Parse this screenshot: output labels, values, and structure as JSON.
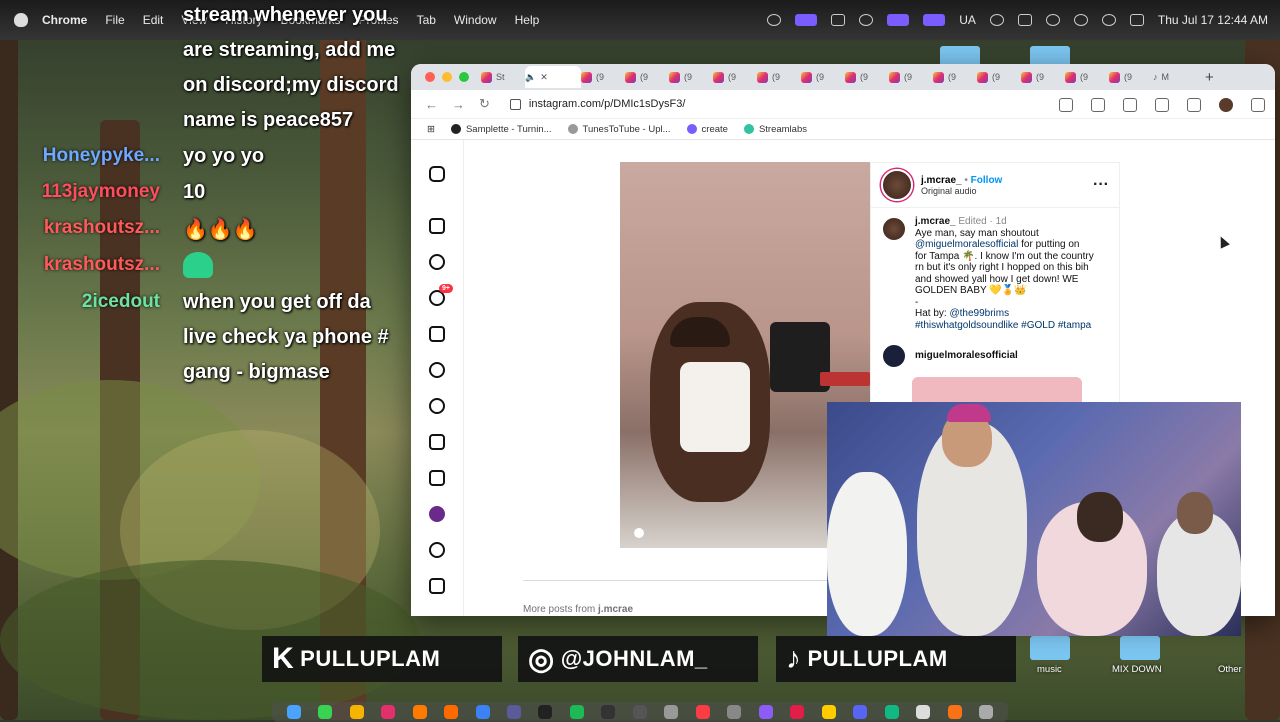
{
  "menubar": {
    "app": "Chrome",
    "items": [
      "File",
      "Edit",
      "View",
      "History",
      "Bookmarks",
      "Profiles",
      "Tab",
      "Window",
      "Help"
    ],
    "right": {
      "input": "UA",
      "datetime": "Thu Jul 17  12:44 AM"
    }
  },
  "chat": {
    "lines": [
      {
        "user": "",
        "text": "stream whenever you"
      },
      {
        "user": "",
        "text": "are streaming, add me"
      },
      {
        "user": "",
        "text": "on discord;my discord"
      },
      {
        "user": "",
        "text": "name is peace857"
      },
      {
        "user": "Honeypyke...",
        "text": "yo yo yo",
        "color": "#6fa8ff"
      },
      {
        "user": "113jaymoney",
        "text": "10",
        "color": "#ff4d5e"
      },
      {
        "user": "krashoutsz...",
        "text": "🔥🔥🔥",
        "color": "#ff5a5a"
      },
      {
        "user": "krashoutsz...",
        "text": "",
        "color": "#ff5a5a"
      },
      {
        "user": "2icedout",
        "text": "when you get off da",
        "color": "#6de3a3"
      },
      {
        "user": "",
        "text": "live check ya phone #"
      },
      {
        "user": "",
        "text": "gang - bigmase"
      }
    ]
  },
  "browser": {
    "tab_label": "St",
    "tab_count_label": "(9",
    "last_tab_label": "M",
    "url": "instagram.com/p/DMIc1sDysF3/",
    "bookmarks": [
      "Samplette - Turnin...",
      "TunesToTube - Upl...",
      "create",
      "Streamlabs"
    ]
  },
  "instagram": {
    "author": "j.mcrae_",
    "follow": "Follow",
    "audio": "Original audio",
    "caption_author": "j.mcrae_",
    "caption_meta": "Edited · 1d",
    "caption_1": "Aye man, say man shoutout",
    "caption_mention": "@miguelmoralesofficial",
    "caption_2": " for putting on",
    "caption_3": "for Tampa 🌴. I know I'm out the country",
    "caption_4": "rn but it's only right I hopped on this bih",
    "caption_5": "and showed yall how I get down! WE",
    "caption_6": "GOLDEN BABY 💛🏅👑",
    "caption_dash": "-",
    "hat_by": "Hat by: ",
    "hat_link": "@the99brims",
    "tags": "#thiswhatgoldsoundlike #GOLD #tampa",
    "comment_user": "miguelmoralesofficial",
    "more_posts_prefix": "More posts from ",
    "more_posts_user": "j.mcrae",
    "notif_badge": "9+"
  },
  "banner": [
    {
      "logo": "K",
      "text": "PULLUPLAM"
    },
    {
      "logo": "◎",
      "text": "@JOHNLAM_"
    },
    {
      "logo": "♪",
      "text": "PULLUPLAM"
    }
  ],
  "desktop": {
    "labels": [
      "music",
      "MIX DOWN",
      "Other"
    ]
  }
}
